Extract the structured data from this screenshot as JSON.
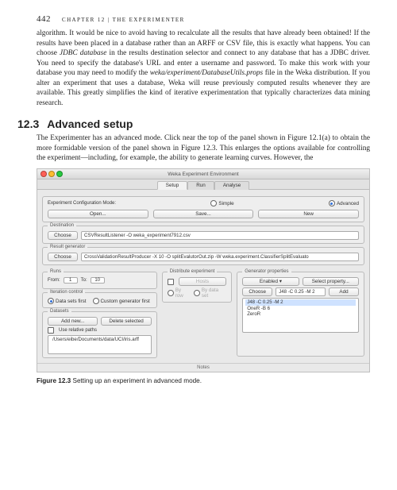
{
  "page_number": "442",
  "chapter_header": "CHAPTER 12 | THE EXPERIMENTER",
  "para1_html": "algorithm. It would be nice to avoid having to recalculate all the results that have already been obtained! If the results have been placed in a database rather than an ARFF or CSV file, this is exactly what happens. You can choose <em>JDBC data­base</em> in the results destination selector and connect to any database that has a JDBC driver. You need to specify the database's URL and enter a username and password. To make this work with your database you may need to modify the <em>weka/experiment/DatabaseUtils.props</em> file in the Weka distribution. If you alter an experiment that uses a database, Weka will reuse previously computed results whenever they are available. This greatly simplifies the kind of iterative experi­mentation that typically characterizes data mining research.",
  "section_num": "12.3",
  "section_title": "Advanced setup",
  "para2": "The Experimenter has an advanced mode. Click near the top of the panel shown in Figure 12.1(a) to obtain the more formidable version of the panel shown in Figure 12.3. This enlarges the options available for controlling the experiment—including, for example, the ability to generate learning curves. However, the",
  "figure": {
    "window_title": "Weka Experiment Environment",
    "tabs": [
      "Setup",
      "Run",
      "Analyse"
    ],
    "active_tab": 0,
    "config_mode": {
      "title": "Experiment Configuration Mode:",
      "options": [
        "Simple",
        "Advanced"
      ],
      "selected": 1
    },
    "toolbar_buttons": [
      "Open...",
      "Save...",
      "New"
    ],
    "destination": {
      "title": "Destination",
      "choose": "Choose",
      "value": "CSVResultListener -O weka_experiment7912.csv"
    },
    "result_gen": {
      "title": "Result generator",
      "choose": "Choose",
      "value": "CrossValidationResultProducer -X 10 -O splitEvalutorOut.zip -W weka.experiment.ClassifierSplitEvaluato"
    },
    "runs": {
      "title": "Runs",
      "from_label": "From:",
      "from": "1",
      "to_label": "To:",
      "to": "10"
    },
    "dist": {
      "title": "Distribute experiment",
      "hosts": "Hosts",
      "opts": [
        "By row",
        "By data set"
      ]
    },
    "genprops": {
      "title": "Generator properties",
      "enabled": "Enabled",
      "select": "Select property...",
      "choose": "Choose",
      "selected_algo": "J48 -C 0.25 -M 2",
      "add": "Add",
      "list": [
        "J48 -C 0.25 -M 2",
        "OneR -B 6",
        "ZeroR"
      ]
    },
    "iter": {
      "title": "Iteration control",
      "opts": [
        "Data sets first",
        "Custom generator first"
      ],
      "selected": 0
    },
    "datasets": {
      "title": "Datasets",
      "add": "Add new...",
      "delete": "Delete selected",
      "relpaths": "Use relative paths",
      "list": [
        "/Users/eibe/Documents/data/UCI/iris.arff"
      ]
    },
    "notes": "Notes"
  },
  "caption_num": "Figure 12.3",
  "caption_text": "Setting up an experiment in advanced mode."
}
